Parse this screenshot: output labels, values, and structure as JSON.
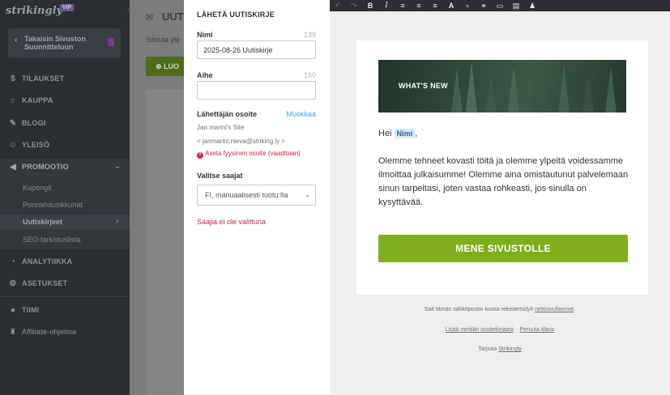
{
  "sidebar": {
    "logo": "strikingly",
    "vip_badge": "VIP",
    "back_label": "Takaisin Sivuston Suunnitteluun",
    "items": [
      {
        "label": "TILAUKSET"
      },
      {
        "label": "KAUPPA"
      },
      {
        "label": "BLOGI"
      },
      {
        "label": "YLEISÖ"
      },
      {
        "label": "PROMOOTIO"
      },
      {
        "label": "ANALYTIIKKA"
      },
      {
        "label": "ASETUKSET"
      },
      {
        "label": "TIIMI"
      },
      {
        "label": "Affiliate-ohjelma"
      }
    ],
    "promo_sub": [
      {
        "label": "Kupongit"
      },
      {
        "label": "Ponnahdusikkunat"
      },
      {
        "label": "Uutiskirjeet"
      },
      {
        "label": "SEO-tarkistuslista"
      }
    ]
  },
  "background": {
    "title": "UUTIS",
    "subtitle": "Sitouta yle",
    "create_button": "LUO"
  },
  "panel": {
    "title": "LÄHETÄ UUTISKIRJE",
    "name_label": "Nimi",
    "name_count": "139",
    "name_value": "2025-08-26 Uutiskirje",
    "subject_label": "Aihe",
    "subject_count": "160",
    "subject_value": "",
    "sender_label": "Lähettäjän osoite",
    "edit_link": "Muokkaa",
    "sender_name": "Jan marini's Site",
    "sender_email": "< janmarini.nieva@striking.ly >",
    "address_error": "Aseta fyysinen osoite (vaaditaan)",
    "recipients_label": "Valitse saajat",
    "recipients_value": "FI, manuaalisesti tuotu:lta",
    "no_recipients": "Saajia ei ole valittuna"
  },
  "preview": {
    "banner_text": "WHAT'S NEW",
    "greeting": "Hei",
    "name_tag": "Nimi",
    "greeting_suffix": ",",
    "body": "Olemme tehneet kovasti töitä ja olemme ylpeitä voidessamme ilmoittaa julkaisumme! Olemme aina omistautunut palvelemaan sinun tarpeitasi, joten vastaa rohkeasti, jos sinulla on kysyttävää.",
    "cta": "MENE SIVUSTOLLE",
    "footer_line1_prefix": "Sait tämän sähköpostin koska rekisteröidyit",
    "footer_line1_link": "nettisivullamme",
    "footer_line1_suffix": ".",
    "footer_add": "Lisää meidän osoitekirjaasi",
    "footer_cancel": "Peruuta tilaus",
    "footer_by": "Tarjoaa",
    "footer_brand": "Strikingly"
  },
  "colors": {
    "accent_green": "#7fad1e",
    "link_blue": "#3ea2d6",
    "error_red": "#d0243c"
  }
}
